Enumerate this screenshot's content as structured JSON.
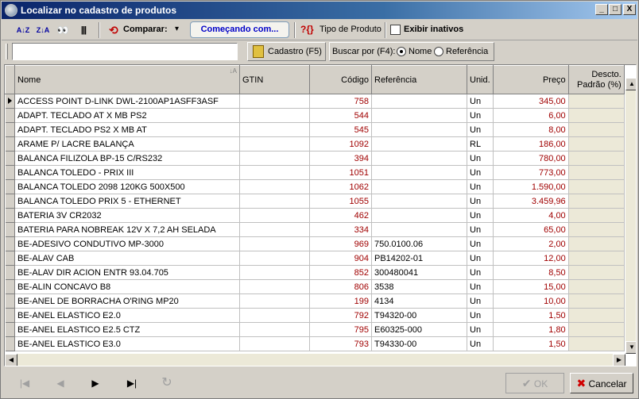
{
  "window": {
    "title": "Localizar no cadastro de produtos"
  },
  "titlebar_buttons": {
    "minimize": "_",
    "maximize": "□",
    "close": "X"
  },
  "toolbar": {
    "sort_az": "A↓Z",
    "sort_za": "Z↓A",
    "binoculars": "👀",
    "barcode": "|||",
    "comparar_label": "Comparar:",
    "comparar_arrow": "▾",
    "comecando_label": "Começando com...",
    "tipo_produto_label": "Tipo de Produto",
    "exibir_inativos_label": "Exibir inativos"
  },
  "search": {
    "value": "",
    "placeholder": ""
  },
  "cadastro_button": "Cadastro (F5)",
  "buscar_por": {
    "label": "Buscar por (F4):",
    "options": [
      "Nome",
      "Referência"
    ],
    "selected": "Nome"
  },
  "grid": {
    "headers": [
      "Nome",
      "GTIN",
      "Código",
      "Referência",
      "Unid.",
      "Preço",
      "Descto. Padrão (%)"
    ],
    "sort_indicator": "↓A",
    "rows": [
      {
        "nome": "ACCESS POINT D-LINK DWL-2100AP1ASFF3ASF",
        "gtin": "",
        "codigo": "758",
        "referencia": "",
        "unid": "Un",
        "preco": "345,00"
      },
      {
        "nome": "ADAPT. TECLADO AT X MB PS2",
        "gtin": "",
        "codigo": "544",
        "referencia": "",
        "unid": "Un",
        "preco": "6,00"
      },
      {
        "nome": "ADAPT. TECLADO PS2 X MB AT",
        "gtin": "",
        "codigo": "545",
        "referencia": "",
        "unid": "Un",
        "preco": "8,00"
      },
      {
        "nome": "ARAME P/ LACRE BALANÇA",
        "gtin": "",
        "codigo": "1092",
        "referencia": "",
        "unid": "RL",
        "preco": "186,00"
      },
      {
        "nome": "BALANCA FILIZOLA BP-15 C/RS232",
        "gtin": "",
        "codigo": "394",
        "referencia": "",
        "unid": "Un",
        "preco": "780,00"
      },
      {
        "nome": "BALANCA TOLEDO - PRIX III",
        "gtin": "",
        "codigo": "1051",
        "referencia": "",
        "unid": "Un",
        "preco": "773,00"
      },
      {
        "nome": "BALANCA TOLEDO 2098 120KG 500X500",
        "gtin": "",
        "codigo": "1062",
        "referencia": "",
        "unid": "Un",
        "preco": "1.590,00"
      },
      {
        "nome": "BALANCA TOLEDO PRIX 5 - ETHERNET",
        "gtin": "",
        "codigo": "1055",
        "referencia": "",
        "unid": "Un",
        "preco": "3.459,96"
      },
      {
        "nome": "BATERIA 3V CR2032",
        "gtin": "",
        "codigo": "462",
        "referencia": "",
        "unid": "Un",
        "preco": "4,00"
      },
      {
        "nome": "BATERIA PARA NOBREAK 12V X 7,2 AH SELADA",
        "gtin": "",
        "codigo": "334",
        "referencia": "",
        "unid": "Un",
        "preco": "65,00"
      },
      {
        "nome": "BE-ADESIVO CONDUTIVO MP-3000",
        "gtin": "",
        "codigo": "969",
        "referencia": "750.0100.06",
        "unid": "Un",
        "preco": "2,00"
      },
      {
        "nome": "BE-ALAV CAB",
        "gtin": "",
        "codigo": "904",
        "referencia": "PB14202-01",
        "unid": "Un",
        "preco": "12,00"
      },
      {
        "nome": "BE-ALAV DIR ACION ENTR 93.04.705",
        "gtin": "",
        "codigo": "852",
        "referencia": "300480041",
        "unid": "Un",
        "preco": "8,50"
      },
      {
        "nome": "BE-ALIN CONCAVO B8",
        "gtin": "",
        "codigo": "806",
        "referencia": "3538",
        "unid": "Un",
        "preco": "15,00"
      },
      {
        "nome": "BE-ANEL DE BORRACHA O'RING MP20",
        "gtin": "",
        "codigo": "199",
        "referencia": "4134",
        "unid": "Un",
        "preco": "10,00"
      },
      {
        "nome": "BE-ANEL ELASTICO E2.0",
        "gtin": "",
        "codigo": "792",
        "referencia": "T94320-00",
        "unid": "Un",
        "preco": "1,50"
      },
      {
        "nome": "BE-ANEL ELASTICO E2.5 CTZ",
        "gtin": "",
        "codigo": "795",
        "referencia": "E60325-000",
        "unid": "Un",
        "preco": "1,80"
      },
      {
        "nome": "BE-ANEL ELASTICO E3.0",
        "gtin": "",
        "codigo": "793",
        "referencia": "T94330-00",
        "unid": "Un",
        "preco": "1,50"
      }
    ]
  },
  "nav": {
    "first": "|◀",
    "prev": "◀",
    "next": "▶",
    "last": "▶|",
    "refresh": "↻"
  },
  "buttons": {
    "ok": "OK",
    "cancel": "Cancelar"
  }
}
